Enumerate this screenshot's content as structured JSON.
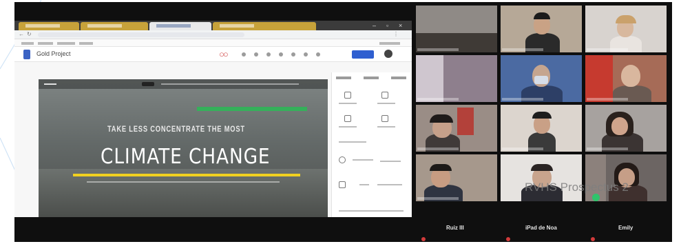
{
  "shared_screen": {
    "app_title": "Gold Project",
    "website": {
      "headline": "CLIMATE CHANGE",
      "subhead": "TAKE LESS CONCENTRATE THE MOST"
    }
  },
  "participants": [
    {
      "name": "Ruiz III"
    },
    {
      "name": "iPad de Noa"
    },
    {
      "name": "Emily"
    }
  ],
  "watermark": "RVHS Prospectus 2",
  "colors": {
    "meeting_bg": "#0f0f0f",
    "accent_green": "#35b05a",
    "accent_yellow": "#f0d020",
    "publish_blue": "#2f5fd0"
  }
}
